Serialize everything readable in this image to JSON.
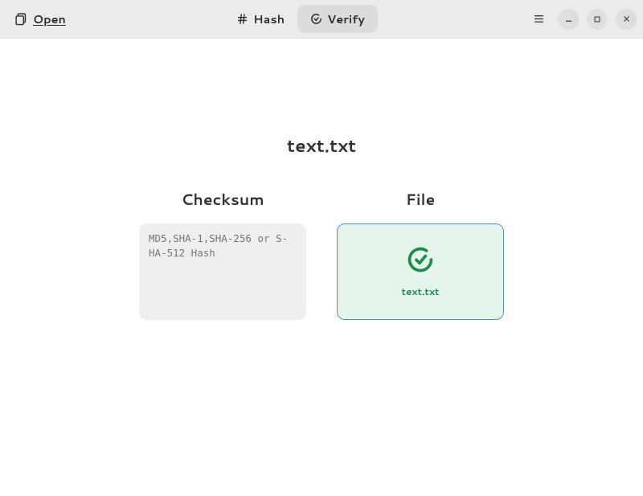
{
  "header": {
    "open_label": "Open",
    "tabs": {
      "hash": "Hash",
      "verify": "Verify",
      "active": "verify"
    }
  },
  "main": {
    "filename": "text.txt",
    "checksum": {
      "title": "Checksum",
      "placeholder": "MD5,SHA-1,SHA-256 or S-\nHA-512 Hash",
      "value": ""
    },
    "file": {
      "title": "File",
      "selected_name": "text.txt",
      "status_color": "#1a8b4a"
    }
  }
}
